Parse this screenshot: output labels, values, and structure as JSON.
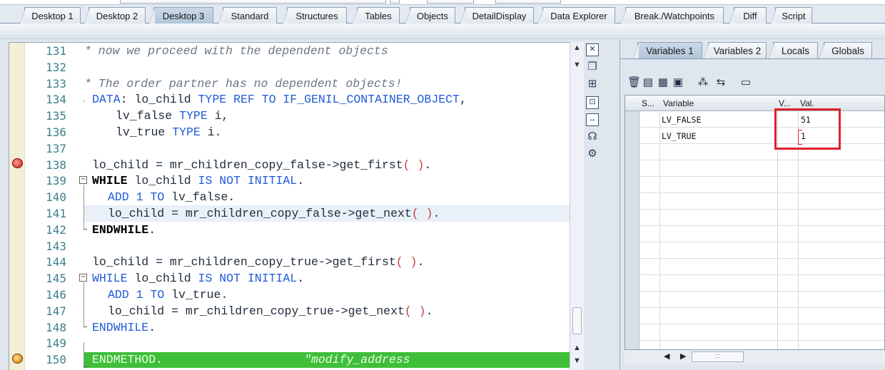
{
  "main_tabs": [
    {
      "label": "Desktop 1"
    },
    {
      "label": "Desktop 2"
    },
    {
      "label": "Desktop 3",
      "active": true
    },
    {
      "label": "Standard"
    },
    {
      "label": "Structures"
    },
    {
      "label": "Tables"
    },
    {
      "label": "Objects"
    },
    {
      "label": "DetailDisplay"
    },
    {
      "label": "Data Explorer"
    },
    {
      "label": "Break./Watchpoints"
    },
    {
      "label": "Diff"
    },
    {
      "label": "Script"
    }
  ],
  "code_lines": [
    {
      "num": "131",
      "text": "* now we proceed with the dependent objects"
    },
    {
      "num": "132",
      "text": ""
    },
    {
      "num": "133",
      "text": "* The order partner has no dependent objects!"
    },
    {
      "num": "134",
      "text": "DATA: lo_child TYPE REF TO IF_GENIL_CONTAINER_OBJECT,"
    },
    {
      "num": "135",
      "text": "lv_false TYPE i,"
    },
    {
      "num": "136",
      "text": "lv_true TYPE i."
    },
    {
      "num": "137",
      "text": ""
    },
    {
      "num": "138",
      "text": "lo_child = mr_children_copy_false->get_first( )."
    },
    {
      "num": "139",
      "text": "WHILE lo_child IS NOT INITIAL."
    },
    {
      "num": "140",
      "text": "ADD 1 TO lv_false."
    },
    {
      "num": "141",
      "text": "lo_child = mr_children_copy_false->get_next( )."
    },
    {
      "num": "142",
      "text": "ENDWHILE."
    },
    {
      "num": "143",
      "text": ""
    },
    {
      "num": "144",
      "text": "lo_child = mr_children_copy_true->get_first( )."
    },
    {
      "num": "145",
      "text": "WHILE lo_child IS NOT INITIAL."
    },
    {
      "num": "146",
      "text": "ADD 1 TO lv_true."
    },
    {
      "num": "147",
      "text": "lo_child = mr_children_copy_true->get_next( )."
    },
    {
      "num": "148",
      "text": "ENDWHILE."
    },
    {
      "num": "149",
      "text": ""
    },
    {
      "num": "150",
      "text": "ENDMETHOD.                    \"modify_address"
    }
  ],
  "right_tabs": [
    {
      "label": "Variables 1",
      "active": true
    },
    {
      "label": "Variables 2"
    },
    {
      "label": "Locals"
    },
    {
      "label": "Globals"
    }
  ],
  "grid": {
    "headers": {
      "s": "S...",
      "variable": "Variable",
      "v": "V...",
      "val": "Val."
    },
    "rows": [
      {
        "variable": "LV_FALSE",
        "value": "51"
      },
      {
        "variable": "LV_TRUE",
        "value": "1"
      }
    ]
  },
  "icons": {
    "breakpoint_138": "breakpoint-icon",
    "breakpoint_150": "current-statement-icon"
  },
  "colors": {
    "current_line": "#3fbe3a",
    "highlight_line": "#e9f0f8",
    "highlight_box": "#e0202a"
  }
}
